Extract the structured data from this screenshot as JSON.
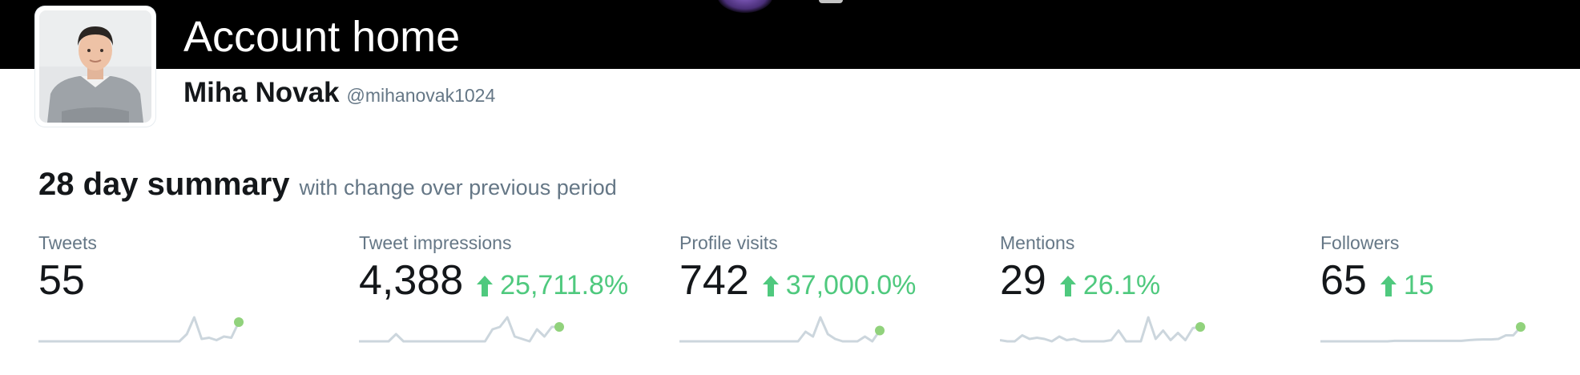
{
  "header": {
    "title": "Account home"
  },
  "profile": {
    "name": "Miha Novak",
    "handle": "@mihanovak1024"
  },
  "summary": {
    "heading": "28 day summary",
    "subheading": "with change over previous period"
  },
  "metrics": [
    {
      "label": "Tweets",
      "value": "55",
      "change": "",
      "sparkline": [
        0,
        0,
        0,
        0,
        0,
        0,
        0,
        0,
        0,
        0,
        0,
        0,
        0,
        0,
        0,
        0,
        0,
        0,
        0,
        0,
        0.3,
        1,
        0.1,
        0.15,
        0.05,
        0.2,
        0.15,
        0.8
      ]
    },
    {
      "label": "Tweet impressions",
      "value": "4,388",
      "change": "25,711.8%",
      "sparkline": [
        0,
        0,
        0,
        0,
        0,
        0.3,
        0,
        0,
        0,
        0,
        0,
        0,
        0,
        0,
        0,
        0,
        0,
        0,
        0.5,
        0.6,
        1,
        0.2,
        0.1,
        0,
        0.5,
        0.2,
        0.6,
        0.6
      ]
    },
    {
      "label": "Profile visits",
      "value": "742",
      "change": "37,000.0%",
      "sparkline": [
        0,
        0,
        0,
        0,
        0,
        0,
        0,
        0,
        0,
        0,
        0,
        0,
        0,
        0,
        0,
        0,
        0,
        0.4,
        0.2,
        1,
        0.3,
        0.1,
        0,
        0,
        0,
        0.2,
        0,
        0.45
      ]
    },
    {
      "label": "Mentions",
      "value": "29",
      "change": "26.1%",
      "sparkline": [
        0.05,
        0,
        0,
        0.25,
        0.1,
        0.15,
        0.1,
        0,
        0.2,
        0.05,
        0.1,
        0,
        0,
        0,
        0,
        0.05,
        0.45,
        0,
        0,
        0,
        1,
        0.1,
        0.45,
        0.05,
        0.35,
        0.05,
        0.55,
        0.6
      ]
    },
    {
      "label": "Followers",
      "value": "65",
      "change": "15",
      "sparkline": [
        0,
        0,
        0,
        0,
        0,
        0,
        0,
        0,
        0,
        0,
        0.02,
        0.02,
        0.02,
        0.02,
        0.02,
        0.02,
        0.02,
        0.02,
        0.02,
        0.02,
        0.05,
        0.07,
        0.08,
        0.08,
        0.1,
        0.25,
        0.25,
        0.6
      ]
    }
  ],
  "colors": {
    "positive": "#4fc97e",
    "sparkline_line": "#ccd6dd",
    "sparkline_dot": "#91d27c",
    "banner": "#000000"
  }
}
